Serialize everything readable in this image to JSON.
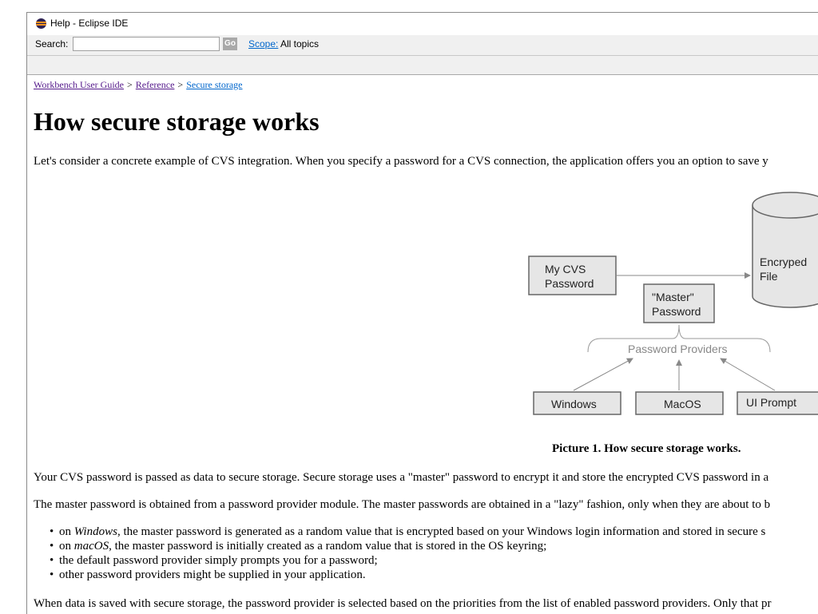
{
  "window": {
    "title": "Help - Eclipse IDE"
  },
  "search": {
    "label": "Search:",
    "value": "",
    "placeholder": "",
    "go_label": "Go",
    "scope_link": "Scope:",
    "scope_value": "All topics"
  },
  "breadcrumb": {
    "items": [
      "Workbench User Guide",
      "Reference",
      "Secure storage"
    ],
    "separator": ">"
  },
  "page": {
    "title": "How secure storage works",
    "intro": "Let's consider a concrete example of CVS integration. When you specify a password for a CVS connection, the application offers you an option to save y",
    "para2": "Your CVS password is passed as data to secure storage. Secure storage uses a \"master\" password to encrypt it and store the encrypted CVS password in a",
    "para3": "The master password is obtained from a password provider module. The master passwords are obtained in a \"lazy\" fashion, only when they are about to b",
    "bullets": [
      {
        "prefix": "on ",
        "em": "Windows",
        "rest": ", the master password is generated as a random value that is encrypted based on your Windows login information and stored in secure s"
      },
      {
        "prefix": "on ",
        "em": "macOS",
        "rest": ", the master password is initially created as a random value that is stored in the OS keyring;"
      },
      {
        "text": "the default password provider simply prompts you for a password;"
      },
      {
        "text": "other password providers might be supplied in your application."
      }
    ],
    "para4": "When data is saved with secure storage, the password provider is selected based on the priorities from the list of enabled password providers. Only that pr"
  },
  "figure": {
    "caption": "Picture 1. How secure storage works.",
    "cvs_box": [
      "My CVS",
      "Password"
    ],
    "master_box": [
      "\"Master\"",
      "Password"
    ],
    "file": [
      "Encryped",
      "File"
    ],
    "providers_label": "Password Providers",
    "providers": [
      "Windows",
      "MacOS",
      "UI Prompt"
    ],
    "colors": {
      "box_fill": "#e6e6e6",
      "box_stroke": "#666666",
      "arrow": "#888888",
      "brace": "#999999"
    }
  }
}
